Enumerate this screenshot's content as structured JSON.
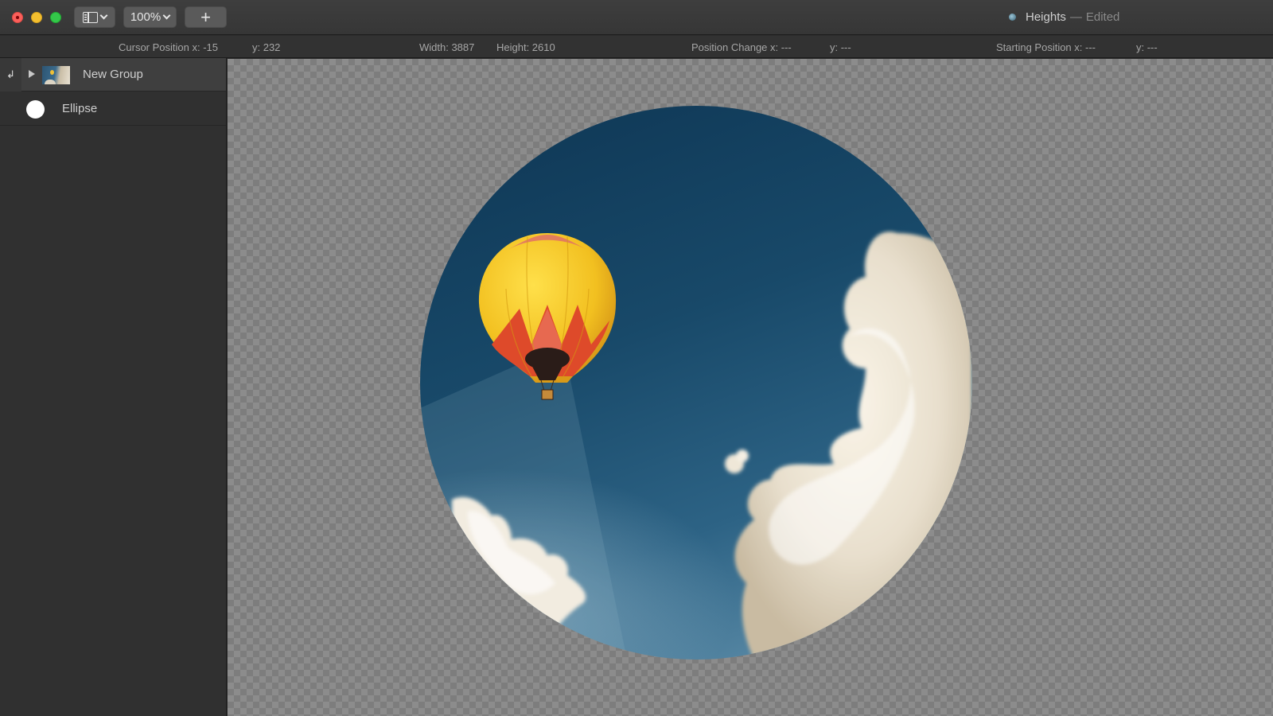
{
  "window": {
    "title": "Heights",
    "separator": "—",
    "state": "Edited",
    "zoom_level": "100%",
    "add_label": "+"
  },
  "infobar": {
    "cursor_x": "Cursor Position x: -15",
    "cursor_y": "y: 232",
    "width": "Width: 3887",
    "height": "Height: 2610",
    "position_change_x": "Position Change x: ---",
    "position_change_y": "y: ---",
    "starting_position_x": "Starting Position x: ---",
    "starting_position_y": "y: ---"
  },
  "layers": [
    {
      "name": "New Group",
      "type": "group",
      "icon": "image-thumbnail",
      "expanded": false,
      "selected": true
    },
    {
      "name": "Ellipse",
      "type": "shape",
      "icon": "ellipse-shape"
    }
  ],
  "canvas": {
    "background": "transparency-checkerboard",
    "content": "hot air balloon photo masked by ellipse"
  },
  "colors": {
    "close": "#fc605b",
    "minimize": "#f4bf2f",
    "maximize": "#34c84a",
    "sky_dark": "#0e3654",
    "sky_light": "#6a98b2",
    "balloon_yellow": "#f6c825",
    "balloon_red": "#d9452a",
    "cloud": "#ece4d4"
  }
}
